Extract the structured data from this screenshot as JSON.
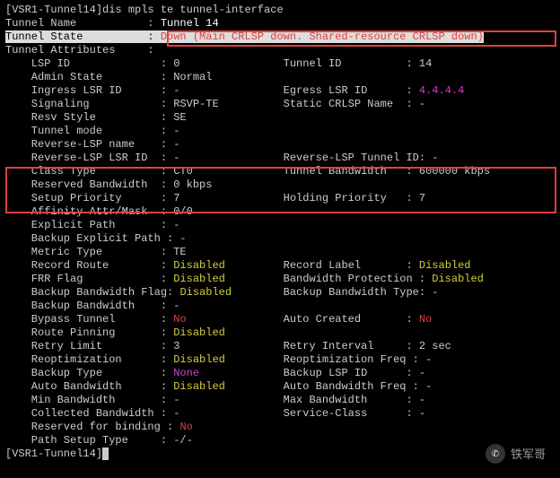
{
  "prompt_line": "[VSR1-Tunnel14]dis mpls te tunnel-interface",
  "rows": [
    [
      {
        "t": "Tunnel Name           : "
      },
      {
        "t": "Tunnel 14",
        "c": "white-text"
      }
    ],
    [
      {
        "t": "Tunnel State          : ",
        "c": "highlight-bg"
      },
      {
        "t": "Down (Main CRLSP down. Shared-resource CRLSP down)",
        "c": "highlight-bg red-text"
      }
    ],
    [
      {
        "t": "Tunnel Attributes     :"
      }
    ],
    [
      {
        "t": "    LSP ID              : 0                Tunnel ID          : 14"
      }
    ],
    [
      {
        "t": "    Admin State         : Normal"
      }
    ],
    [
      {
        "t": "    Ingress LSR ID      : -                Egress LSR ID      : "
      },
      {
        "t": "4.4.4.4",
        "c": "magenta-text"
      }
    ],
    [
      {
        "t": "    Signaling           : RSVP-TE          Static CRLSP Name  : -"
      }
    ],
    [
      {
        "t": "    Resv Style          : SE"
      }
    ],
    [
      {
        "t": "    Tunnel mode         : -"
      }
    ],
    [
      {
        "t": "    Reverse-LSP name    : -"
      }
    ],
    [
      {
        "t": "    Reverse-LSP LSR ID  : -                Reverse-LSP Tunnel ID: -"
      }
    ],
    [
      {
        "t": "    Class Type          : CT0              Tunnel Bandwidth   : 600000 kbps"
      }
    ],
    [
      {
        "t": "    Reserved Bandwidth  : 0 kbps"
      }
    ],
    [
      {
        "t": "    Setup Priority      : 7                Holding Priority   : 7"
      }
    ],
    [
      {
        "t": "    Affinity Attr/Mask  : 0/0"
      }
    ],
    [
      {
        "t": "    Explicit Path       : -"
      }
    ],
    [
      {
        "t": "    Backup Explicit Path : -"
      }
    ],
    [
      {
        "t": "    Metric Type         : TE"
      }
    ],
    [
      {
        "t": "    Record Route        : "
      },
      {
        "t": "Disabled",
        "c": "yellow-text"
      },
      {
        "t": "         Record Label       : "
      },
      {
        "t": "Disabled",
        "c": "yellow-text"
      }
    ],
    [
      {
        "t": "    FRR Flag            : "
      },
      {
        "t": "Disabled",
        "c": "yellow-text"
      },
      {
        "t": "         Bandwidth Protection : "
      },
      {
        "t": "Disabled",
        "c": "yellow-text"
      }
    ],
    [
      {
        "t": "    Backup Bandwidth Flag: "
      },
      {
        "t": "Disabled",
        "c": "yellow-text"
      },
      {
        "t": "        Backup Bandwidth Type: -"
      }
    ],
    [
      {
        "t": "    Backup Bandwidth    : -"
      }
    ],
    [
      {
        "t": "    Bypass Tunnel       : "
      },
      {
        "t": "No",
        "c": "red-text"
      },
      {
        "t": "               Auto Created       : "
      },
      {
        "t": "No",
        "c": "red-text"
      }
    ],
    [
      {
        "t": "    Route Pinning       : "
      },
      {
        "t": "Disabled",
        "c": "yellow-text"
      }
    ],
    [
      {
        "t": "    Retry Limit         : 3                Retry Interval     : 2 sec"
      }
    ],
    [
      {
        "t": "    Reoptimization      : "
      },
      {
        "t": "Disabled",
        "c": "yellow-text"
      },
      {
        "t": "         Reoptimization Freq : -"
      }
    ],
    [
      {
        "t": "    Backup Type         : "
      },
      {
        "t": "None",
        "c": "magenta-text"
      },
      {
        "t": "             Backup LSP ID      : -"
      }
    ],
    [
      {
        "t": "    Auto Bandwidth      : "
      },
      {
        "t": "Disabled",
        "c": "yellow-text"
      },
      {
        "t": "         Auto Bandwidth Freq : -"
      }
    ],
    [
      {
        "t": "    Min Bandwidth       : -                Max Bandwidth      : -"
      }
    ],
    [
      {
        "t": "    Collected Bandwidth : -                Service-Class      : -"
      }
    ],
    [
      {
        "t": "    Reserved for binding : "
      },
      {
        "t": "No",
        "c": "red-text"
      }
    ],
    [
      {
        "t": "    Path Setup Type     : -/-"
      }
    ]
  ],
  "prompt_end": "[VSR1-Tunnel14]",
  "watermark_text": "铁军哥",
  "watermark_icon": "✆"
}
